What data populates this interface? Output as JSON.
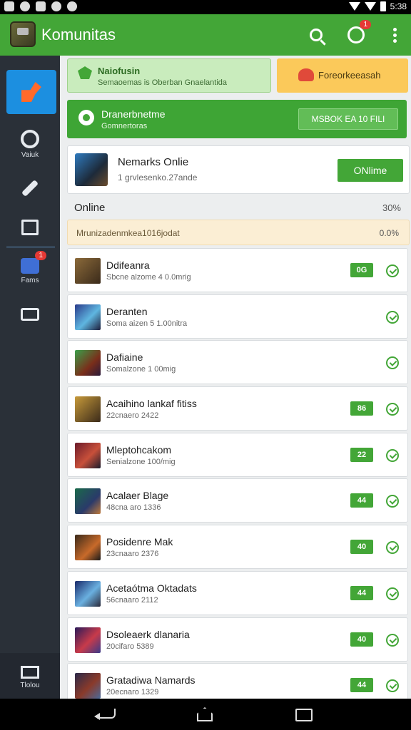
{
  "app": {
    "title": "Komunitas",
    "notification_count": "1"
  },
  "statusbar": {
    "time": "5:38"
  },
  "sidebar": {
    "items": [
      {
        "label": "Vaiuk"
      },
      {
        "label": ""
      },
      {
        "label": ""
      },
      {
        "label": "Fams",
        "badge": "1"
      },
      {
        "label": ""
      }
    ],
    "bottom_label": "Tlolou"
  },
  "banners": {
    "left_title": "Naiofusin",
    "left_subtitle": "Semaoemas is Oberban Gnaelantida",
    "right_label": "Foreorkeeasah"
  },
  "promo": {
    "title": "Dranerbnetme",
    "subtitle": "Gomnertoras",
    "button_label": "MSBOK EA 10 FILI"
  },
  "featured": {
    "title": "Nemarks Onlie",
    "subtitle": "1 grvlesenko.27ande",
    "button_label": "ONlime"
  },
  "section": {
    "title": "Online",
    "value": "30%"
  },
  "notice": {
    "text": "Mrunizadenmkea1016jodat",
    "value": "0.0%"
  },
  "players": [
    {
      "name": "Ddifeanra",
      "sub": "Sbcne alzome 4 0.0mrig",
      "tag": "0G",
      "avatar": "linear-gradient(135deg,#8b6a3a,#3a2a1a)"
    },
    {
      "name": "Deranten",
      "sub": "Soma aizen 5 1.00nitra",
      "tag": "",
      "avatar": "linear-gradient(135deg,#2a3b8b,#5fb6e0 55%,#1d1d3a)"
    },
    {
      "name": "Dafiaine",
      "sub": "Somalzone 1 00mig",
      "tag": "",
      "avatar": "linear-gradient(135deg,#3aa04a,#7a2e1a 60%,#2a1a3a)"
    },
    {
      "name": "Acaihino lankaf fitiss",
      "sub": "22cnaero 2422",
      "tag": "86",
      "avatar": "linear-gradient(135deg,#c79a3a,#3a2a1a)"
    },
    {
      "name": "Mleptohcakom",
      "sub": "Senialzone 100/mig",
      "tag": "22",
      "avatar": "linear-gradient(135deg,#6a1a2a,#c8503a 55%,#1a1a2a)"
    },
    {
      "name": "Acalaer Blage",
      "sub": "48cna aro 1336",
      "tag": "44",
      "avatar": "linear-gradient(135deg,#1a6a4a,#2a3a6a 60%,#c07a3a)"
    },
    {
      "name": "Posidenre Mak",
      "sub": "23cnaaro 2376",
      "tag": "40",
      "avatar": "linear-gradient(135deg,#3a2a1a,#c86a2a 60%,#1a1a1a)"
    },
    {
      "name": "Acetaótma Oktadats",
      "sub": "56cnaaro 2112",
      "tag": "44",
      "avatar": "linear-gradient(135deg,#1a2a6a,#6ab0e0 55%,#2a2a3a)"
    },
    {
      "name": "Dsoleaerk dlanaria",
      "sub": "20cifaro 5389",
      "tag": "40",
      "avatar": "linear-gradient(135deg,#2a1a5a,#c83a4a 55%,#3a3a8a)"
    },
    {
      "name": "Gratadiwa Namards",
      "sub": "20ecnaro 1329",
      "tag": "44",
      "avatar": "linear-gradient(135deg,#2a2a4a,#8a3a2a 55%,#4a6a9a)"
    }
  ]
}
